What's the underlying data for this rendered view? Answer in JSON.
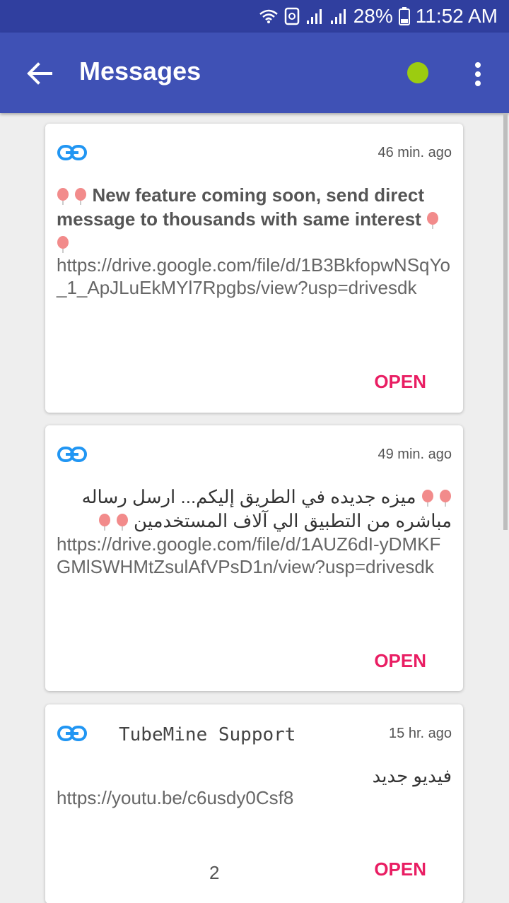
{
  "status_bar": {
    "battery": "28%",
    "time": "11:52 AM",
    "icons": [
      "wifi-icon",
      "sync-icon",
      "signal-icon",
      "signal-icon",
      "battery-icon"
    ]
  },
  "app_bar": {
    "title": "Messages",
    "status_dot_color": "#9CCC10",
    "back_icon": "arrow-left-icon",
    "menu_icon": "more-vert-icon"
  },
  "colors": {
    "primary": "#3F51B5",
    "primary_dark": "#303F9F",
    "accent": "#E91E63",
    "link_icon": "#2196F3"
  },
  "messages": [
    {
      "icon": "link-icon",
      "time": "46 min. ago",
      "title": "New feature coming soon, send direct message to thousands with same interest",
      "link": "https://drive.google.com/file/d/1B3BkfopwNSqYo_1_ApJLuEkMYl7Rpgbs/view?usp=drivesdk",
      "action": "OPEN"
    },
    {
      "icon": "link-icon",
      "time": "49 min. ago",
      "title": "ميزه جديده في الطريق إليكم... ارسل رساله مباشره من التطبيق الي آلاف المستخدمين",
      "link": "https://drive.google.com/file/d/1AUZ6dI-yDMKFGMlSWHMtZsulAfVPsD1n/view?usp=drivesdk",
      "action": "OPEN"
    },
    {
      "icon": "link-icon",
      "sender": "TubeMine Support",
      "time": "15 hr. ago",
      "title": "فيديو جديد",
      "link": "https://youtu.be/c6usdy0Csf8",
      "action": "OPEN"
    }
  ],
  "page_number": "2"
}
